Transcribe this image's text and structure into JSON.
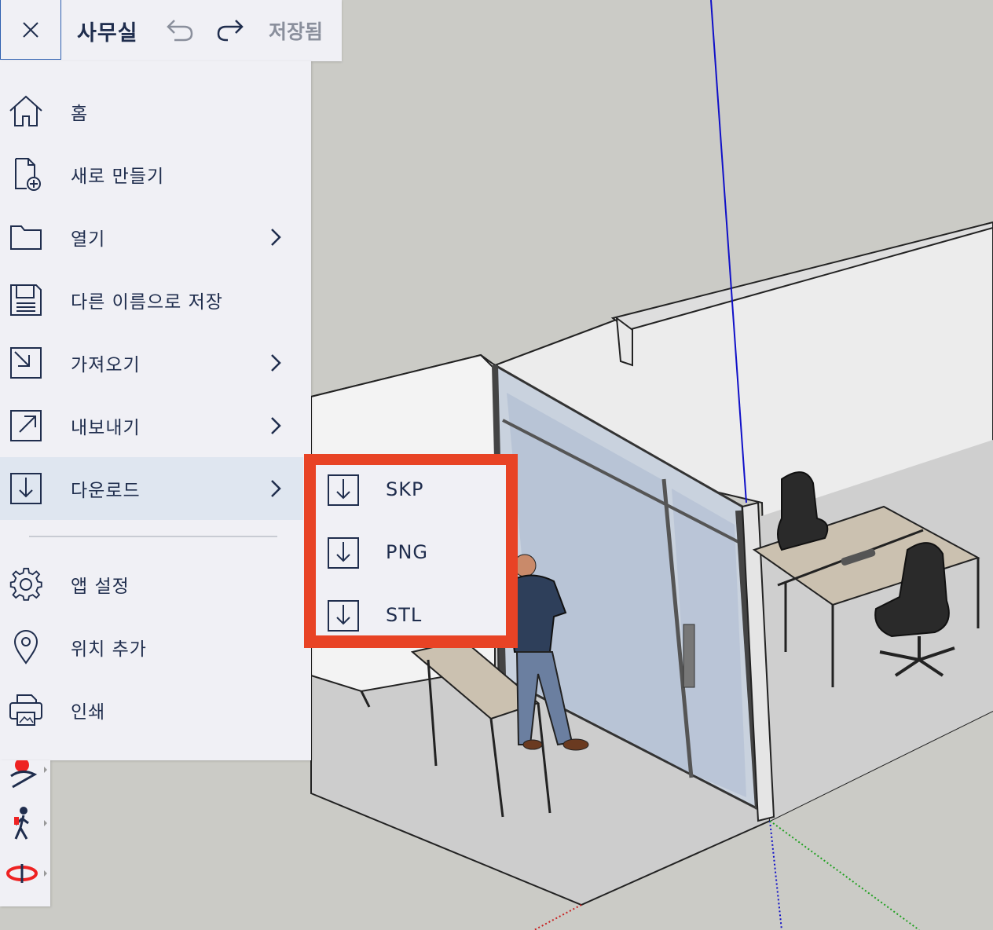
{
  "header": {
    "doc_title": "사무실",
    "saved_status": "저장됨",
    "close_icon": "close-icon",
    "undo_icon": "undo-icon",
    "redo_icon": "redo-icon"
  },
  "menu": {
    "items": [
      {
        "label": "홈",
        "icon": "home-icon"
      },
      {
        "label": "새로 만들기",
        "icon": "new-file-icon"
      },
      {
        "label": "열기",
        "icon": "folder-icon"
      },
      {
        "label": "다른 이름으로 저장",
        "icon": "floppy-disk-icon"
      },
      {
        "label": "가져오기",
        "icon": "import-icon"
      },
      {
        "label": "내보내기",
        "icon": "export-icon"
      },
      {
        "label": "다운로드",
        "icon": "download-icon"
      },
      {
        "label": "앱 설정",
        "icon": "gear-icon"
      },
      {
        "label": "위치 추가",
        "icon": "location-pin-icon"
      },
      {
        "label": "인쇄",
        "icon": "printer-icon"
      }
    ]
  },
  "download_submenu": {
    "items": [
      {
        "label": "SKP",
        "icon": "download-icon"
      },
      {
        "label": "PNG",
        "icon": "download-icon"
      },
      {
        "label": "STL",
        "icon": "download-icon"
      }
    ]
  },
  "toolstrip": {
    "tools": [
      "position-camera-icon",
      "walk-icon",
      "orbit-icon"
    ]
  },
  "colors": {
    "accent_red": "#e84325",
    "panel_bg": "#f0f0f5",
    "text_navy": "#1f2d4d",
    "active_item_bg": "#dfe6f0",
    "axis_blue": "#1010c8"
  }
}
